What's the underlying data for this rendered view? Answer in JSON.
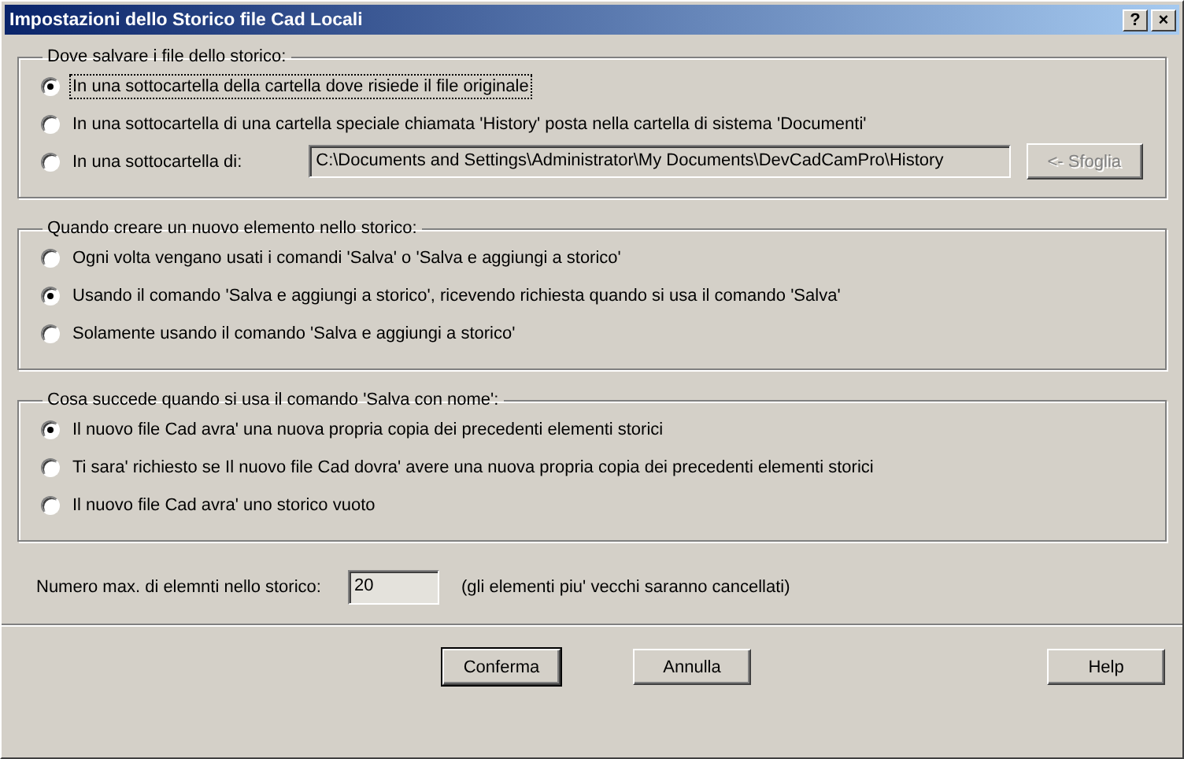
{
  "window": {
    "title": "Impostazioni dello Storico file Cad Locali",
    "title_buttons": [
      "?",
      "×"
    ]
  },
  "groups": [
    {
      "legend": "Dove salvare i file dello storico:",
      "options": [
        {
          "label": "In una sottocartella della cartella dove risiede il file originale",
          "selected": true,
          "focused": true
        },
        {
          "label": "In una sottocartella di una cartella speciale chiamata 'History' posta nella cartella di sistema 'Documenti'",
          "selected": false,
          "focused": false
        },
        {
          "label": "In una sottocartella di:",
          "selected": false,
          "focused": false,
          "path": "C:\\Documents and Settings\\Administrator\\My Documents\\DevCadCamPro\\History",
          "browse": {
            "label": "<- Sfoglia",
            "disabled": true
          }
        }
      ]
    },
    {
      "legend": "Quando creare un nuovo elemento nello storico:",
      "options": [
        {
          "label": "Ogni volta vengano usati i comandi 'Salva' o 'Salva e aggiungi a storico'",
          "selected": false,
          "focused": false
        },
        {
          "label": "Usando il comando 'Salva e aggiungi a storico', ricevendo richiesta quando si usa il comando 'Salva'",
          "selected": true,
          "focused": false
        },
        {
          "label": "Solamente usando il comando 'Salva e aggiungi a storico'",
          "selected": false,
          "focused": false
        }
      ]
    },
    {
      "legend": "Cosa succede quando si usa il comando 'Salva con nome':",
      "options": [
        {
          "label": "Il nuovo file Cad avra' una nuova propria copia dei precedenti elementi storici",
          "selected": true,
          "focused": false
        },
        {
          "label": "Ti sara' richiesto se Il nuovo file Cad dovra' avere una nuova propria copia dei precedenti elementi storici",
          "selected": false,
          "focused": false
        },
        {
          "label": "Il nuovo file Cad avra' uno storico vuoto",
          "selected": false,
          "focused": false
        }
      ]
    }
  ],
  "max_items": {
    "label": "Numero max. di elemnti nello storico:",
    "value": "20",
    "disabled": true,
    "note": "(gli elementi piu' vecchi saranno cancellati)"
  },
  "buttons": [
    {
      "label": "Conferma",
      "default": true
    },
    {
      "label": "Annulla",
      "default": false
    },
    {
      "label": "Help",
      "default": false
    }
  ]
}
